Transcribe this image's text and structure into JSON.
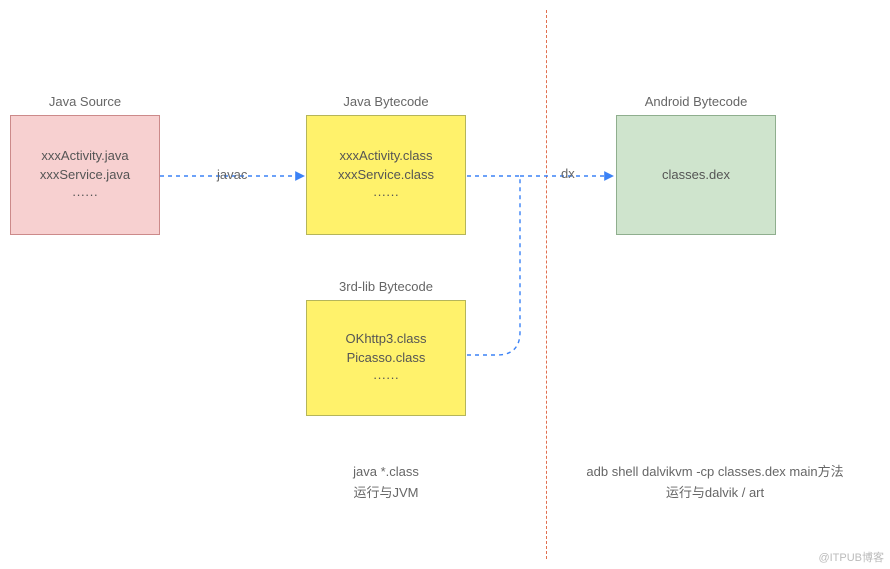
{
  "boxes": {
    "javaSource": {
      "title": "Java Source",
      "line1": "xxxActivity.java",
      "line2": "xxxService.java",
      "line3": "······"
    },
    "javaBytecode": {
      "title": "Java Bytecode",
      "line1": "xxxActivity.class",
      "line2": "xxxService.class",
      "line3": "······"
    },
    "thirdLib": {
      "title": "3rd-lib Bytecode",
      "line1": "OKhttp3.class",
      "line2": "Picasso.class",
      "line3": "······"
    },
    "androidBytecode": {
      "title": "Android Bytecode",
      "line1": "classes.dex"
    }
  },
  "arrows": {
    "javac": "javac",
    "dx": "dx"
  },
  "captions": {
    "left": {
      "line1": "java *.class",
      "line2": "运行与JVM"
    },
    "right": {
      "line1": "adb shell dalvikvm -cp  classes.dex  main方法",
      "line2": "运行与dalvik / art"
    }
  },
  "watermark": "@ITPUB博客"
}
